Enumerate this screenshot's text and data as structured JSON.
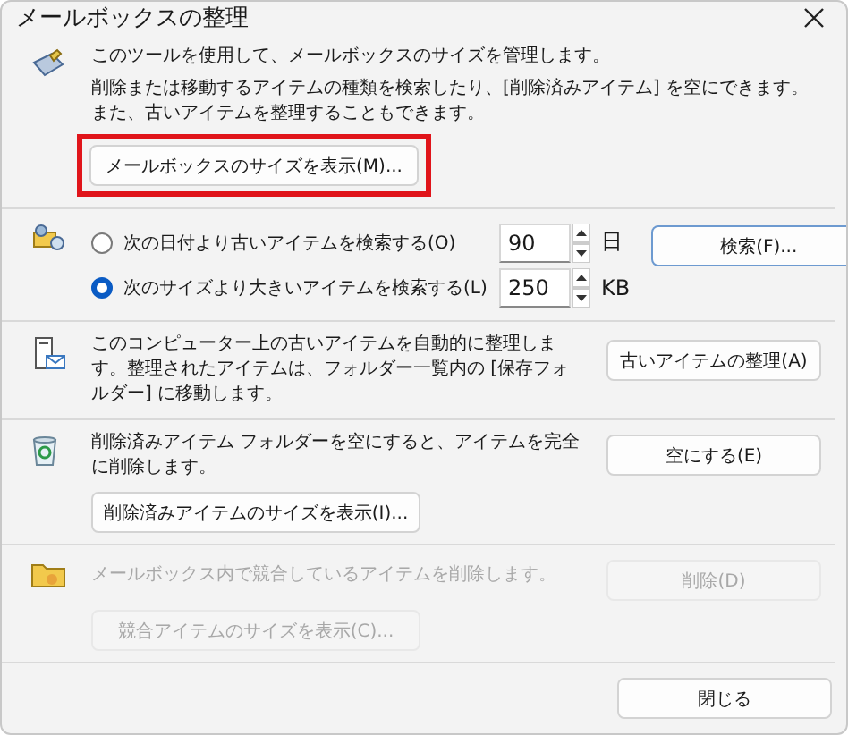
{
  "window": {
    "title": "メールボックスの整理"
  },
  "mailbox_size": {
    "description": [
      "このツールを使用して、メールボックスのサイズを管理します。",
      "削除または移動するアイテムの種類を検索したり、[削除済みアイテム] を空にできます。また、古いアイテムを整理することもできます。"
    ],
    "button": {
      "label": "メールボックスのサイズを表示(M)...",
      "highlighted": true
    }
  },
  "search": {
    "options": [
      {
        "label": "次の日付より古いアイテムを検索する(O)",
        "selected": false,
        "value": "90",
        "unit": "日"
      },
      {
        "label": "次のサイズより大きいアイテムを検索する(L)",
        "selected": true,
        "value": "250",
        "unit": "KB"
      }
    ],
    "button": {
      "label": "検索(F)...",
      "focused": true
    }
  },
  "autoarchive": {
    "description": "このコンピューター上の古いアイテムを自動的に整理します。整理されたアイテムは、フォルダー一覧内の [保存フォルダー] に移動します。",
    "button": {
      "label": "古いアイテムの整理(A)"
    }
  },
  "deleted_items": {
    "description": "削除済みアイテム フォルダーを空にすると、アイテムを完全に削除します。",
    "empty_button": {
      "label": "空にする(E)",
      "disabled": false
    },
    "size_button": {
      "label": "削除済みアイテムのサイズを表示(I)...",
      "disabled": false
    }
  },
  "conflicts": {
    "description": "メールボックス内で競合しているアイテムを削除します。",
    "disabled": true,
    "delete_button": {
      "label": "削除(D)",
      "disabled": true
    },
    "size_button": {
      "label": "競合アイテムのサイズを表示(C)...",
      "disabled": true
    }
  },
  "close_button": {
    "label": "閉じる"
  }
}
